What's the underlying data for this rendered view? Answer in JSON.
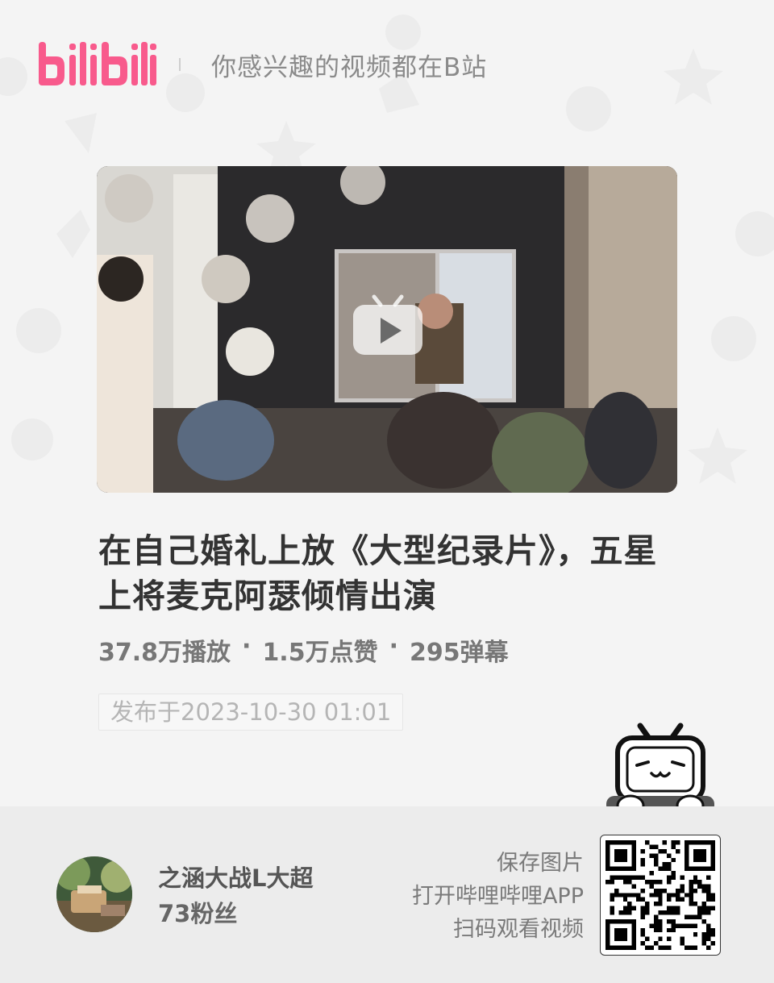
{
  "header": {
    "logo_text": "bilibili",
    "slogan": "你感兴趣的视频都在B站"
  },
  "video": {
    "cover_icon": "play-icon",
    "title": "在自己婚礼上放《大型纪录片》，五星上将麦克阿瑟倾情出演",
    "stats": {
      "views": "37.8万播放",
      "likes": "1.5万点赞",
      "danmaku": "295弹幕",
      "separator": "·"
    },
    "published": "发布于2023-10-30 01:01"
  },
  "author": {
    "name": "之涵大战L大超",
    "fans": "73粉丝"
  },
  "promo": {
    "line1": "保存图片",
    "line2": "打开哔哩哔哩APP",
    "line3": "扫码观看视频"
  },
  "colors": {
    "brand_pink": "#f85a8c",
    "background": "#f4f4f4",
    "footer": "#ececec"
  }
}
